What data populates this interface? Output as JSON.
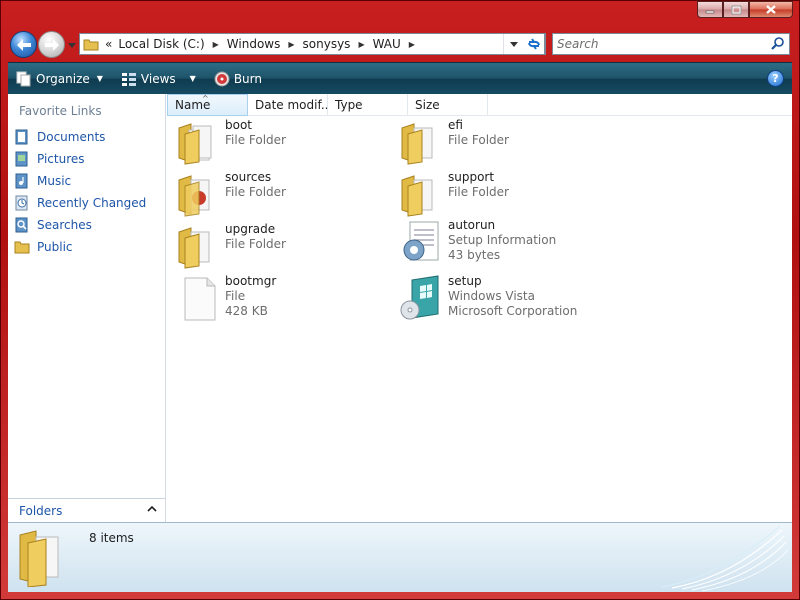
{
  "window": {
    "caption": {
      "minimize": "–",
      "maximize": "□",
      "close": "✕"
    }
  },
  "nav": {
    "address": {
      "overflow": "«",
      "crumbs": [
        "Local Disk (C:)",
        "Windows",
        "sonysys",
        "WAU"
      ]
    },
    "search": {
      "placeholder": "Search"
    }
  },
  "toolbar": {
    "organize": "Organize",
    "views": "Views",
    "burn": "Burn",
    "help": "?"
  },
  "sidebar": {
    "title": "Favorite Links",
    "items": [
      {
        "label": "Documents",
        "icon": "documents-icon"
      },
      {
        "label": "Pictures",
        "icon": "pictures-icon"
      },
      {
        "label": "Music",
        "icon": "music-icon"
      },
      {
        "label": "Recently Changed",
        "icon": "recent-icon"
      },
      {
        "label": "Searches",
        "icon": "searches-icon"
      },
      {
        "label": "Public",
        "icon": "public-icon"
      }
    ],
    "folders_label": "Folders"
  },
  "columns": [
    "Name",
    "Date modif...",
    "Type",
    "Size"
  ],
  "items": [
    {
      "name": "boot",
      "line1": "File Folder",
      "line2": "",
      "icon": "folder-icon"
    },
    {
      "name": "efi",
      "line1": "File Folder",
      "line2": "",
      "icon": "folder-icon"
    },
    {
      "name": "sources",
      "line1": "File Folder",
      "line2": "",
      "icon": "folder-icon"
    },
    {
      "name": "support",
      "line1": "File Folder",
      "line2": "",
      "icon": "folder-icon"
    },
    {
      "name": "upgrade",
      "line1": "File Folder",
      "line2": "",
      "icon": "folder-icon"
    },
    {
      "name": "autorun",
      "line1": "Setup Information",
      "line2": "43 bytes",
      "icon": "setup-info-icon"
    },
    {
      "name": "bootmgr",
      "line1": "File",
      "line2": "428 KB",
      "icon": "file-icon"
    },
    {
      "name": "setup",
      "line1": "Windows Vista",
      "line2": "Microsoft Corporation",
      "icon": "setup-app-icon"
    }
  ],
  "details": {
    "count": "8 items"
  }
}
